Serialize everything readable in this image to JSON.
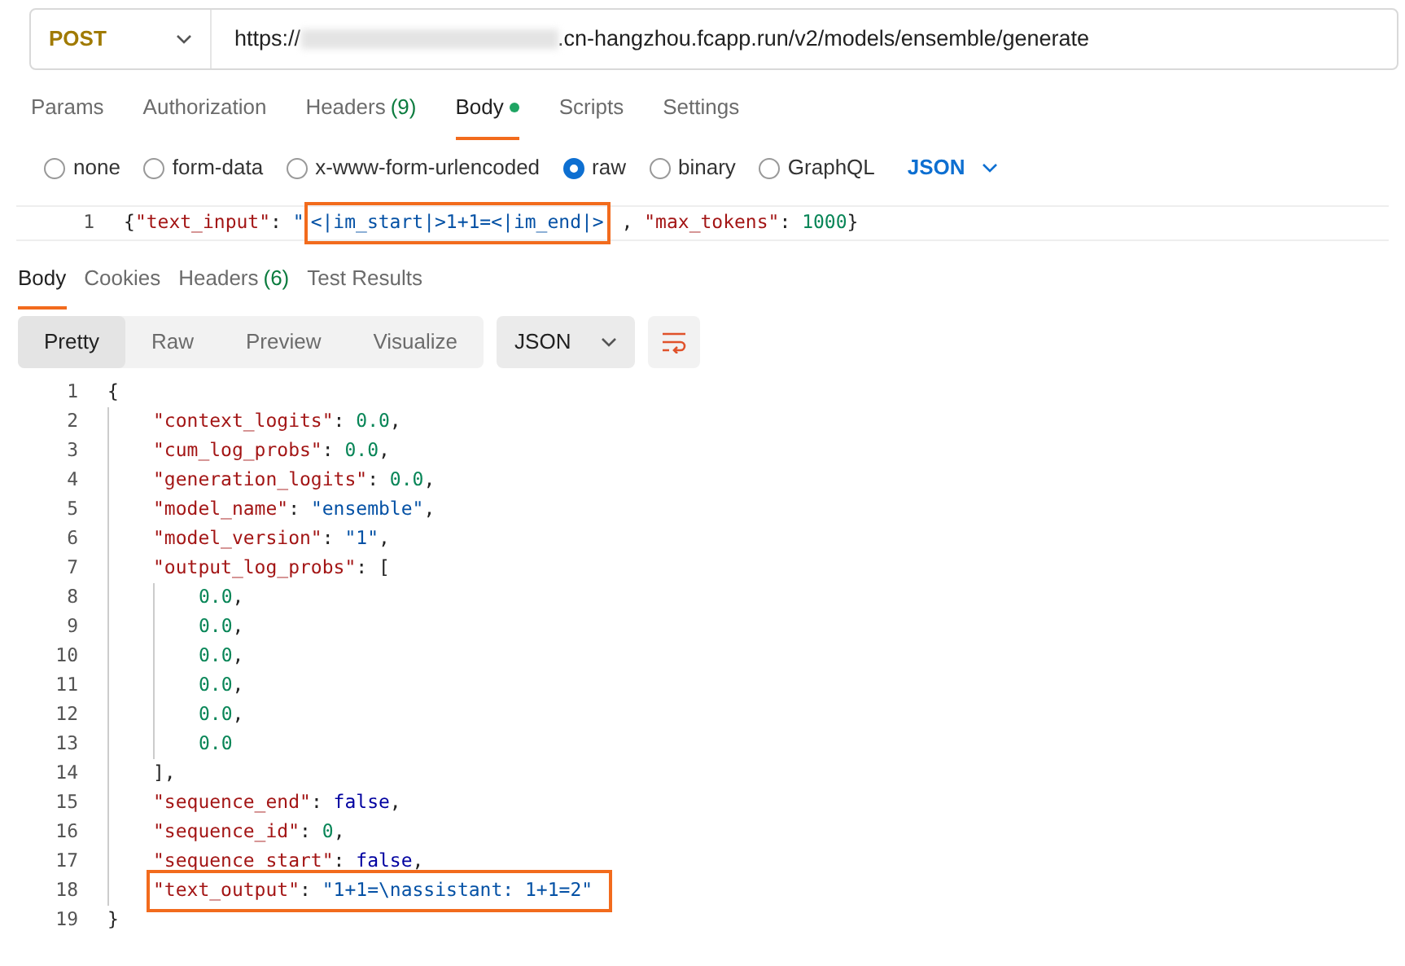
{
  "request": {
    "method": "POST",
    "url_prefix": "https://",
    "url_suffix": ".cn-hangzhou.fcapp.run/v2/models/ensemble/generate"
  },
  "request_tabs": [
    {
      "label": "Params",
      "selected": false
    },
    {
      "label": "Authorization",
      "selected": false
    },
    {
      "label": "Headers",
      "count": "(9)",
      "selected": false
    },
    {
      "label": "Body",
      "selected": true,
      "dot": true
    },
    {
      "label": "Scripts",
      "selected": false
    },
    {
      "label": "Settings",
      "selected": false
    }
  ],
  "body_types": [
    {
      "label": "none",
      "selected": false
    },
    {
      "label": "form-data",
      "selected": false
    },
    {
      "label": "x-www-form-urlencoded",
      "selected": false
    },
    {
      "label": "raw",
      "selected": true
    },
    {
      "label": "binary",
      "selected": false
    },
    {
      "label": "GraphQL",
      "selected": false
    }
  ],
  "raw_format": "JSON",
  "request_body": [
    {
      "number": "1",
      "highlighted": false,
      "tokens": [
        {
          "kind": "punct",
          "text": "{"
        },
        {
          "kind": "key",
          "text": "\"text_input\""
        },
        {
          "kind": "punct",
          "text": ": "
        },
        {
          "kind": "string",
          "text": "\""
        },
        {
          "kind": "string",
          "text": "<|im_start|>1+1=<|im_end|>",
          "highlighted": true
        },
        {
          "kind": "punct",
          "text": " , "
        },
        {
          "kind": "key",
          "text": "\"max_tokens\""
        },
        {
          "kind": "punct",
          "text": ": "
        },
        {
          "kind": "number",
          "text": "1000"
        },
        {
          "kind": "punct",
          "text": "}"
        }
      ]
    }
  ],
  "response_tabs": [
    {
      "label": "Body",
      "selected": true
    },
    {
      "label": "Cookies",
      "selected": false
    },
    {
      "label": "Headers",
      "count": "(6)",
      "selected": false
    },
    {
      "label": "Test Results",
      "selected": false
    }
  ],
  "view_modes": [
    {
      "label": "Pretty",
      "selected": true
    },
    {
      "label": "Raw",
      "selected": false
    },
    {
      "label": "Preview",
      "selected": false
    },
    {
      "label": "Visualize",
      "selected": false
    }
  ],
  "response_format": "JSON",
  "response_body": [
    {
      "number": "1",
      "highlighted": false,
      "tokens": [
        {
          "kind": "punct",
          "text": "{"
        }
      ],
      "children": [
        {
          "number": "2",
          "highlighted": false,
          "tokens": [
            {
              "kind": "key",
              "text": "\"context_logits\""
            },
            {
              "kind": "punct",
              "text": ": "
            },
            {
              "kind": "number",
              "text": "0.0"
            },
            {
              "kind": "punct",
              "text": ","
            }
          ]
        },
        {
          "number": "3",
          "highlighted": false,
          "tokens": [
            {
              "kind": "key",
              "text": "\"cum_log_probs\""
            },
            {
              "kind": "punct",
              "text": ": "
            },
            {
              "kind": "number",
              "text": "0.0"
            },
            {
              "kind": "punct",
              "text": ","
            }
          ]
        },
        {
          "number": "4",
          "highlighted": false,
          "tokens": [
            {
              "kind": "key",
              "text": "\"generation_logits\""
            },
            {
              "kind": "punct",
              "text": ": "
            },
            {
              "kind": "number",
              "text": "0.0"
            },
            {
              "kind": "punct",
              "text": ","
            }
          ]
        },
        {
          "number": "5",
          "highlighted": false,
          "tokens": [
            {
              "kind": "key",
              "text": "\"model_name\""
            },
            {
              "kind": "punct",
              "text": ": "
            },
            {
              "kind": "string",
              "text": "\"ensemble\""
            },
            {
              "kind": "punct",
              "text": ","
            }
          ]
        },
        {
          "number": "6",
          "highlighted": false,
          "tokens": [
            {
              "kind": "key",
              "text": "\"model_version\""
            },
            {
              "kind": "punct",
              "text": ": "
            },
            {
              "kind": "string",
              "text": "\"1\""
            },
            {
              "kind": "punct",
              "text": ","
            }
          ]
        },
        {
          "number": "7",
          "highlighted": false,
          "tokens": [
            {
              "kind": "key",
              "text": "\"output_log_probs\""
            },
            {
              "kind": "punct",
              "text": ": ["
            }
          ],
          "children": [
            {
              "number": "8",
              "highlighted": false,
              "tokens": [
                {
                  "kind": "number",
                  "text": "0.0"
                },
                {
                  "kind": "punct",
                  "text": ","
                }
              ]
            },
            {
              "number": "9",
              "highlighted": false,
              "tokens": [
                {
                  "kind": "number",
                  "text": "0.0"
                },
                {
                  "kind": "punct",
                  "text": ","
                }
              ]
            },
            {
              "number": "10",
              "highlighted": false,
              "tokens": [
                {
                  "kind": "number",
                  "text": "0.0"
                },
                {
                  "kind": "punct",
                  "text": ","
                }
              ]
            },
            {
              "number": "11",
              "highlighted": false,
              "tokens": [
                {
                  "kind": "number",
                  "text": "0.0"
                },
                {
                  "kind": "punct",
                  "text": ","
                }
              ]
            },
            {
              "number": "12",
              "highlighted": false,
              "tokens": [
                {
                  "kind": "number",
                  "text": "0.0"
                },
                {
                  "kind": "punct",
                  "text": ","
                }
              ]
            },
            {
              "number": "13",
              "highlighted": false,
              "tokens": [
                {
                  "kind": "number",
                  "text": "0.0"
                }
              ]
            }
          ]
        },
        {
          "number": "14",
          "highlighted": false,
          "tokens": [
            {
              "kind": "punct",
              "text": "],"
            }
          ]
        },
        {
          "number": "15",
          "highlighted": false,
          "tokens": [
            {
              "kind": "key",
              "text": "\"sequence_end\""
            },
            {
              "kind": "punct",
              "text": ": "
            },
            {
              "kind": "bool",
              "text": "false"
            },
            {
              "kind": "punct",
              "text": ","
            }
          ]
        },
        {
          "number": "16",
          "highlighted": false,
          "tokens": [
            {
              "kind": "key",
              "text": "\"sequence_id\""
            },
            {
              "kind": "punct",
              "text": ": "
            },
            {
              "kind": "number",
              "text": "0"
            },
            {
              "kind": "punct",
              "text": ","
            }
          ]
        },
        {
          "number": "17",
          "highlighted": false,
          "tokens": [
            {
              "kind": "key",
              "text": "\"sequence_start\""
            },
            {
              "kind": "punct",
              "text": ": "
            },
            {
              "kind": "bool",
              "text": "false"
            },
            {
              "kind": "punct",
              "text": ","
            }
          ]
        },
        {
          "number": "18",
          "highlighted": true,
          "tokens": [
            {
              "kind": "key",
              "text": "\"text_output\""
            },
            {
              "kind": "punct",
              "text": ": "
            },
            {
              "kind": "string",
              "text": "\"1+1=\\nassistant: 1+1=2\""
            }
          ]
        }
      ]
    },
    {
      "number": "19",
      "highlighted": false,
      "tokens": [
        {
          "kind": "punct",
          "text": "}"
        }
      ]
    }
  ]
}
